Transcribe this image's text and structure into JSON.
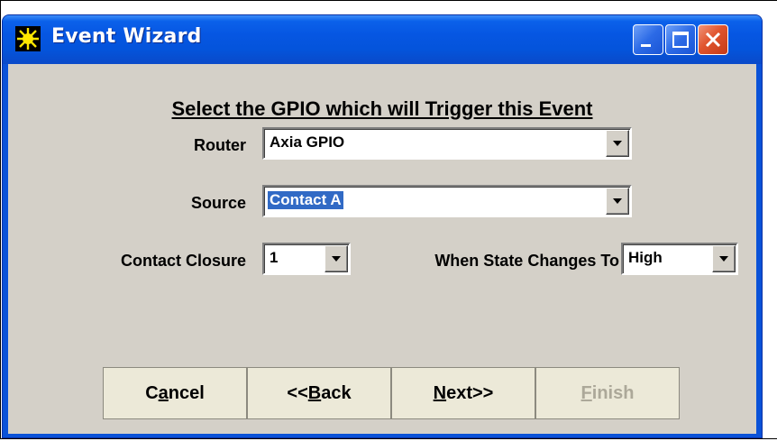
{
  "window": {
    "title": "Event Wizard",
    "icon": "sun-burst-icon",
    "controls": [
      "minimize-icon",
      "maximize-icon",
      "close-icon"
    ]
  },
  "heading": "Select the GPIO which will Trigger this Event",
  "fields": {
    "router": {
      "label": "Router",
      "value": "Axia GPIO"
    },
    "source": {
      "label": "Source",
      "value": "Contact A"
    },
    "contact_closure": {
      "label": "Contact Closure",
      "value": "1"
    },
    "state": {
      "label": "When State Changes To",
      "value": "High"
    }
  },
  "buttons": {
    "cancel": {
      "before": "C",
      "mnemonic": "a",
      "after": "ncel"
    },
    "back": {
      "before": "<<",
      "mnemonic": "B",
      "after": "ack"
    },
    "next": {
      "before": "",
      "mnemonic": "N",
      "after": "ext>>"
    },
    "finish": {
      "before": "",
      "mnemonic": "F",
      "after": "inish",
      "disabled": true
    }
  },
  "colors": {
    "title_bar": "#0a52d8",
    "client_bg": "#d4d0c8",
    "selection": "#316ac5",
    "close_button": "#e0542d"
  }
}
